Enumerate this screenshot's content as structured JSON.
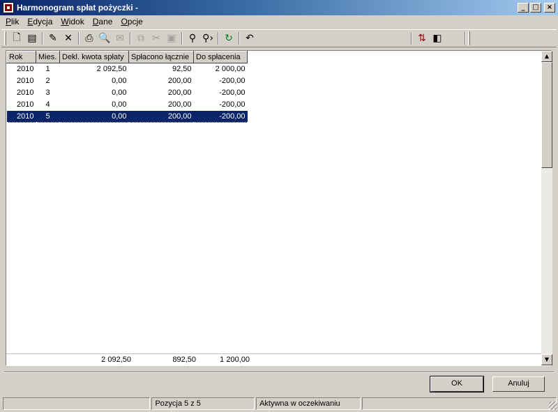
{
  "window": {
    "title": "Harmonogram spłat pożyczki -",
    "buttons": {
      "minimize": "_",
      "maximize": "□",
      "close": "×"
    }
  },
  "menu": [
    {
      "label": "Plik",
      "u": "P",
      "rest": "lik"
    },
    {
      "label": "Edycja",
      "u": "E",
      "rest": "dycja"
    },
    {
      "label": "Widok",
      "u": "W",
      "rest": "idok"
    },
    {
      "label": "Dane",
      "u": "D",
      "rest": "ane"
    },
    {
      "label": "Opcje",
      "u": "O",
      "rest": "pcje"
    }
  ],
  "toolbar": {
    "icons": [
      "new-icon",
      "properties-icon",
      "edit-icon",
      "delete-icon",
      "print-icon",
      "print-preview-icon",
      "email-icon",
      "copy-icon",
      "cut-icon",
      "paste-icon",
      "find-icon",
      "find-next-icon",
      "refresh-icon",
      "undo-icon",
      "tree-icon",
      "columns-icon"
    ]
  },
  "table": {
    "headers": [
      "Rok",
      "Mies.",
      "Dekl. kwota spłaty",
      "Spłacono łącznie",
      "Do spłacenia"
    ],
    "rows": [
      [
        "2010",
        "1",
        "2 092,50",
        "92,50",
        "2 000,00"
      ],
      [
        "2010",
        "2",
        "0,00",
        "200,00",
        "-200,00"
      ],
      [
        "2010",
        "3",
        "0,00",
        "200,00",
        "-200,00"
      ],
      [
        "2010",
        "4",
        "0,00",
        "200,00",
        "-200,00"
      ],
      [
        "2010",
        "5",
        "0,00",
        "200,00",
        "-200,00"
      ]
    ],
    "selected_row": 4,
    "totals": [
      "",
      "",
      "2 092,50",
      "892,50",
      "1 200,00"
    ]
  },
  "buttons": {
    "ok": "OK",
    "cancel": "Anuluj"
  },
  "status": {
    "panel1": "",
    "panel2": "Pozycja 5 z 5",
    "panel3": "Aktywna w oczekiwaniu",
    "panel4": ""
  },
  "colors": {
    "selection": "#0a246a",
    "titlebar": "#0a246a",
    "face": "#d4d0c8"
  }
}
